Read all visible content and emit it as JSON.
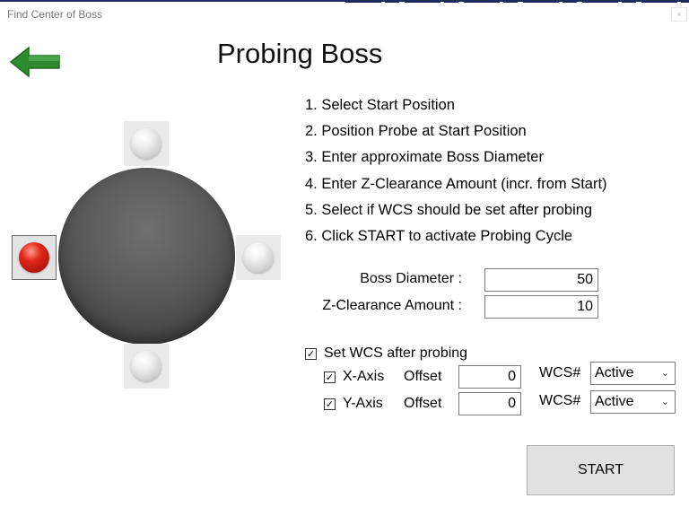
{
  "window": {
    "title": "Find Center of Boss",
    "close_label": "×"
  },
  "header": {
    "title": "Probing Boss"
  },
  "icons": {
    "back": "back-arrow-icon",
    "accent": "#2e8b2e"
  },
  "steps": [
    "1. Select Start Position",
    "2. Position Probe at Start Position",
    "3. Enter approximate Boss Diameter",
    "4. Enter Z-Clearance Amount (incr. from Start)",
    "5. Select if WCS should be set after probing",
    "6. Click START to activate Probing Cycle"
  ],
  "start_positions": {
    "selected": "left",
    "options": [
      "top",
      "left",
      "right",
      "bottom"
    ]
  },
  "fields": {
    "boss_diameter": {
      "label": "Boss Diameter :",
      "value": "50"
    },
    "z_clearance": {
      "label": "Z-Clearance Amount :",
      "value": "10"
    }
  },
  "wcs": {
    "set_label": "Set WCS after probing",
    "set_checked": true,
    "check_mark": "✓",
    "x_axis": {
      "label": "X-Axis",
      "offset_label": "Offset",
      "offset_value": "0",
      "wcs_label": "WCS#",
      "wcs_value": "Active",
      "checked": true
    },
    "y_axis": {
      "label": "Y-Axis",
      "offset_label": "Offset",
      "offset_value": "0",
      "wcs_label": "WCS#",
      "wcs_value": "Active",
      "checked": true
    }
  },
  "actions": {
    "start_label": "START"
  }
}
